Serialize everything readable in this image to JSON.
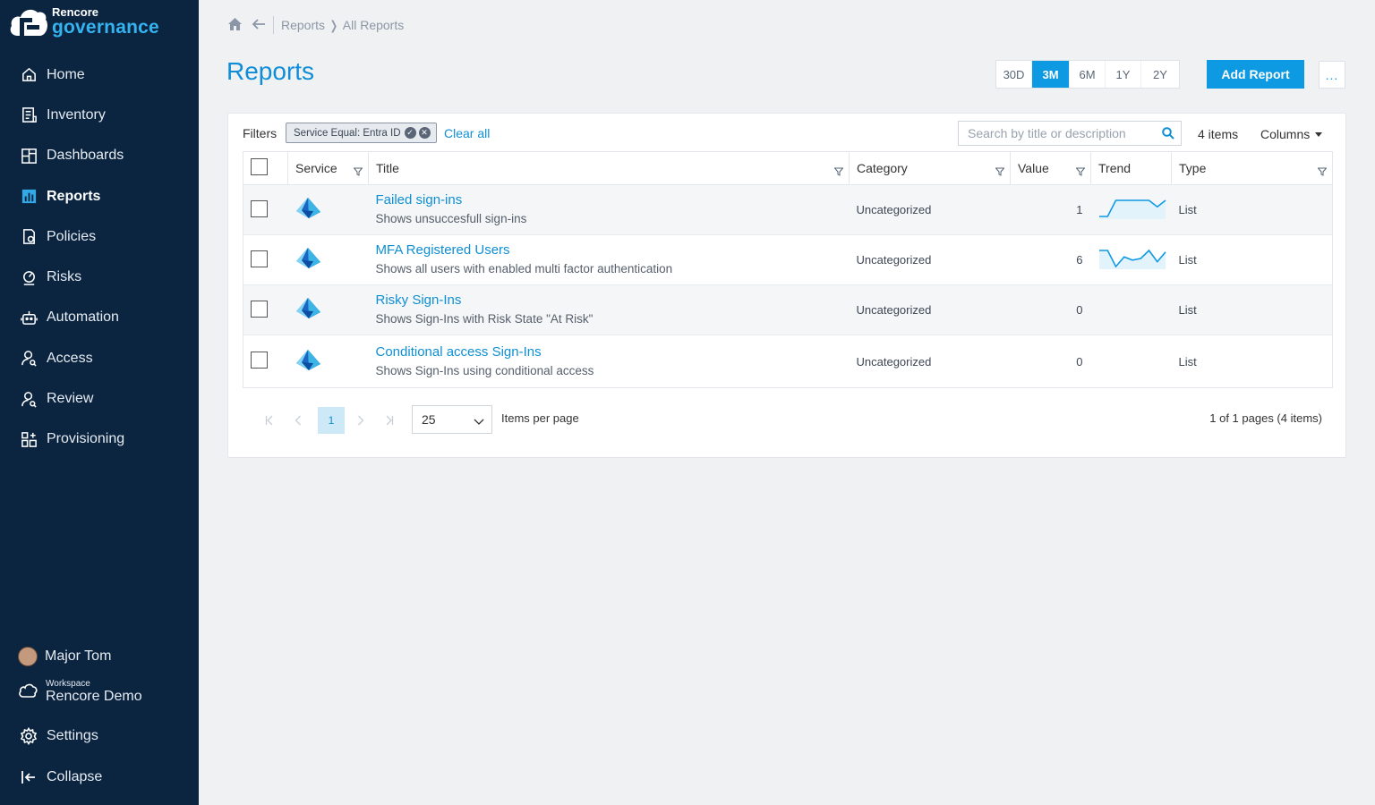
{
  "brand": {
    "company": "Rencore",
    "product": "governance"
  },
  "nav": [
    {
      "label": "Home",
      "icon": "home-icon"
    },
    {
      "label": "Inventory",
      "icon": "inventory-icon"
    },
    {
      "label": "Dashboards",
      "icon": "dashboards-icon"
    },
    {
      "label": "Reports",
      "icon": "reports-icon",
      "active": true
    },
    {
      "label": "Policies",
      "icon": "policies-icon"
    },
    {
      "label": "Risks",
      "icon": "risks-icon"
    },
    {
      "label": "Automation",
      "icon": "automation-icon"
    },
    {
      "label": "Access",
      "icon": "access-icon"
    },
    {
      "label": "Review",
      "icon": "review-icon"
    },
    {
      "label": "Provisioning",
      "icon": "provisioning-icon"
    }
  ],
  "user": {
    "name": "Major Tom"
  },
  "workspace": {
    "label": "Workspace",
    "name": "Rencore Demo"
  },
  "settings_label": "Settings",
  "collapse_label": "Collapse",
  "breadcrumb": {
    "first": "Reports",
    "second": "All Reports"
  },
  "page_title": "Reports",
  "time_ranges": [
    "30D",
    "3M",
    "6M",
    "1Y",
    "2Y"
  ],
  "selected_range": "3M",
  "add_report_label": "Add Report",
  "more_label": "...",
  "filters": {
    "label": "Filters",
    "chip": "Service Equal: Entra ID",
    "clear_all": "Clear all"
  },
  "search": {
    "placeholder": "Search by title or description",
    "value": ""
  },
  "item_count": "4 items",
  "columns_label": "Columns",
  "table": {
    "headers": {
      "service": "Service",
      "title": "Title",
      "category": "Category",
      "value": "Value",
      "trend": "Trend",
      "type": "Type"
    },
    "rows": [
      {
        "title": "Failed sign-ins",
        "description": "Shows unsuccesfull sign-ins",
        "category": "Uncategorized",
        "value": "1",
        "trend": [
          0,
          0,
          1,
          1,
          1,
          1,
          1,
          0.6,
          1
        ],
        "type": "List"
      },
      {
        "title": "MFA Registered Users",
        "description": "Shows all users with enabled multi factor authentication",
        "category": "Uncategorized",
        "value": "6",
        "trend": [
          1,
          1,
          0,
          0.6,
          0.4,
          0.5,
          1,
          0.3,
          0.9
        ],
        "type": "List"
      },
      {
        "title": "Risky Sign-Ins",
        "description": "Shows Sign-Ins with Risk State \"At Risk\"",
        "category": "Uncategorized",
        "value": "0",
        "trend": [],
        "type": "List"
      },
      {
        "title": "Conditional access Sign-Ins",
        "description": "Shows Sign-Ins using conditional access",
        "category": "Uncategorized",
        "value": "0",
        "trend": [],
        "type": "List"
      }
    ]
  },
  "pagination": {
    "current_page": "1",
    "items_per_page": "25",
    "items_per_page_label": "Items per page",
    "summary": "1 of 1 pages (4 items)"
  },
  "colors": {
    "sidebar": "#0b2541",
    "accent": "#0e9ae3",
    "title": "#0f8dd6"
  }
}
